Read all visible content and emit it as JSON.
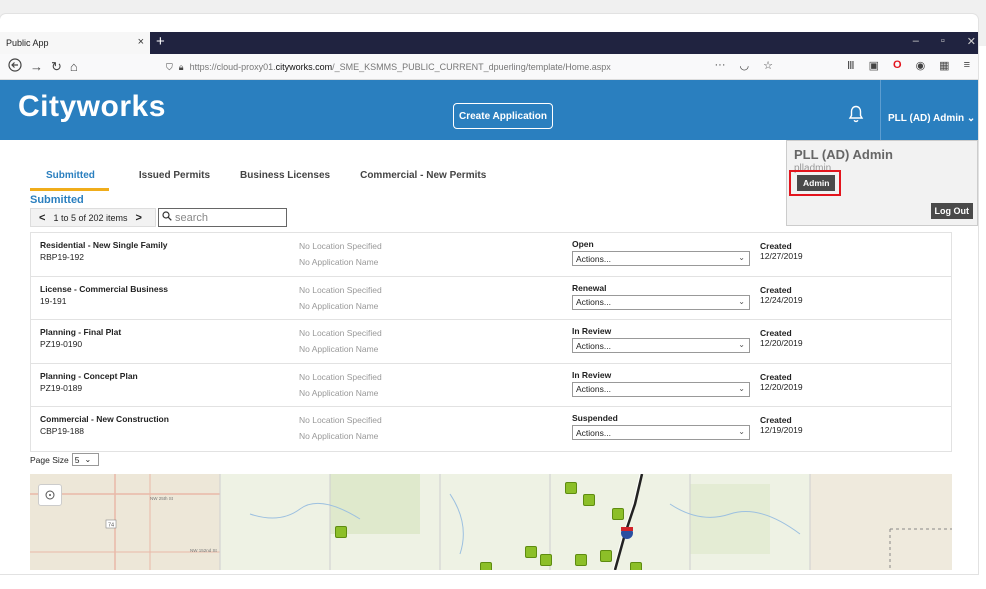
{
  "browser": {
    "tab_title": "Public App",
    "tab_close": "×",
    "new_tab": "+",
    "url_prefix": "https://cloud-proxy01.",
    "url_host": "cityworks.com",
    "url_path": "/_SME_KSMMS_PUBLIC_CURRENT_dpuerling/template/Home.aspx",
    "url_more": "···"
  },
  "header": {
    "logo": "Cityworks",
    "create_application": "Create Application",
    "user_menu": "PLL (AD) Admin ⌄"
  },
  "tabs": [
    {
      "label": "Submitted",
      "active": true
    },
    {
      "label": "Issued Permits"
    },
    {
      "label": "Business Licenses"
    },
    {
      "label": "Commercial - New Permits"
    }
  ],
  "section_title": "Submitted",
  "pager": {
    "prev": "<",
    "text": "1 to 5 of 202 items",
    "next": ">"
  },
  "search": {
    "placeholder": "search"
  },
  "rows": [
    {
      "title": "Residential - New Single Family",
      "id": "RBP19-192",
      "location": "No Location Specified",
      "app_name": "No Application Name",
      "status": "Open",
      "actions": "Actions...",
      "created_label": "Created",
      "date": "12/27/2019"
    },
    {
      "title": "License - Commercial Business",
      "id": "19-191",
      "location": "No Location Specified",
      "app_name": "No Application Name",
      "status": "Renewal",
      "actions": "Actions...",
      "created_label": "Created",
      "date": "12/24/2019"
    },
    {
      "title": "Planning - Final Plat",
      "id": "PZ19-0190",
      "location": "No Location Specified",
      "app_name": "No Application Name",
      "status": "In Review",
      "actions": "Actions...",
      "created_label": "Created",
      "date": "12/20/2019"
    },
    {
      "title": "Planning - Concept Plan",
      "id": "PZ19-0189",
      "location": "No Location Specified",
      "app_name": "No Application Name",
      "status": "In Review",
      "actions": "Actions...",
      "created_label": "Created",
      "date": "12/20/2019"
    },
    {
      "title": "Commercial - New Construction",
      "id": "CBP19-188",
      "location": "No Location Specified",
      "app_name": "No Application Name",
      "status": "Suspended",
      "actions": "Actions...",
      "created_label": "Created",
      "date": "12/19/2019"
    }
  ],
  "page_size": {
    "label": "Page Size",
    "value": "5"
  },
  "user_popup": {
    "name": "PLL (AD) Admin",
    "login": "plladmin",
    "role_badge": "Admin",
    "logout": "Log Out"
  },
  "map": {
    "road_labels": [
      "NW 25th St",
      "NW 152nd St"
    ],
    "highway": "74"
  },
  "colors": {
    "header_blue": "#2a7fbf",
    "tab_underline": "#f0ad1b",
    "highlight_red": "#e3141d",
    "pin_green": "#8cbf28"
  }
}
